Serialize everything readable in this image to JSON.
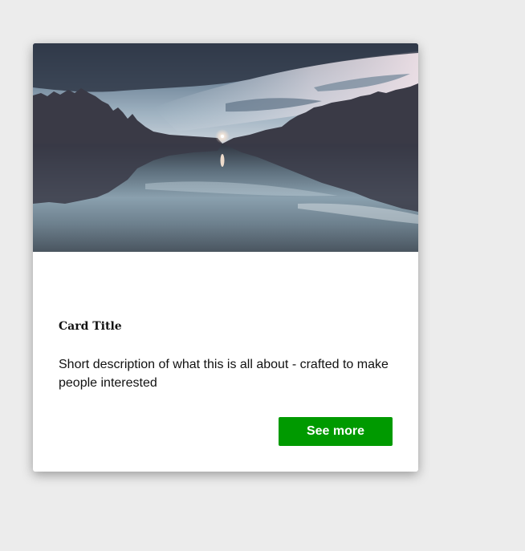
{
  "card": {
    "image_alt": "lake-reflection-at-dusk",
    "title": "Card Title",
    "description": "Short description of what this is all about - crafted to make people interested",
    "button_label": "See more"
  },
  "colors": {
    "page_background": "#ececec",
    "card_background": "#ffffff",
    "button_background": "#009a00",
    "button_text": "#ffffff"
  }
}
